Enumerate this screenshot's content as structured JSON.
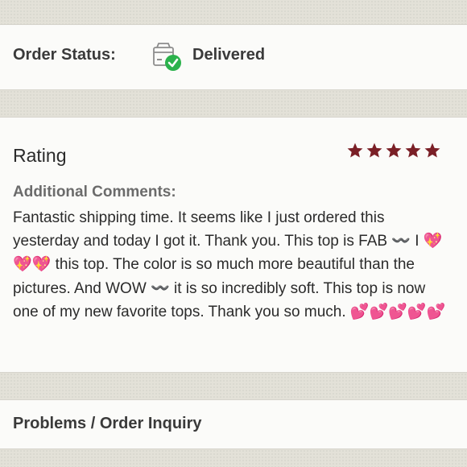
{
  "order_status": {
    "label": "Order Status:",
    "value": "Delivered",
    "icon": "package-delivered-icon",
    "check_color": "#2bb24c"
  },
  "rating": {
    "title": "Rating",
    "stars": 5,
    "max_stars": 5,
    "star_color": "#7a1f26",
    "comments_label": "Additional Comments:",
    "comments": "Fantastic shipping time. It seems like I just ordered this yesterday and today I got it. Thank you. This top is FAB 〰️ I 💖💖💖 this top. The color is so much more beautiful than the pictures. And WOW 〰️ it is so incredibly soft. This top is now one of my new favorite tops. Thank you so much. 💕💕💕💕💕"
  },
  "problems": {
    "label": "Problems / Order Inquiry"
  }
}
